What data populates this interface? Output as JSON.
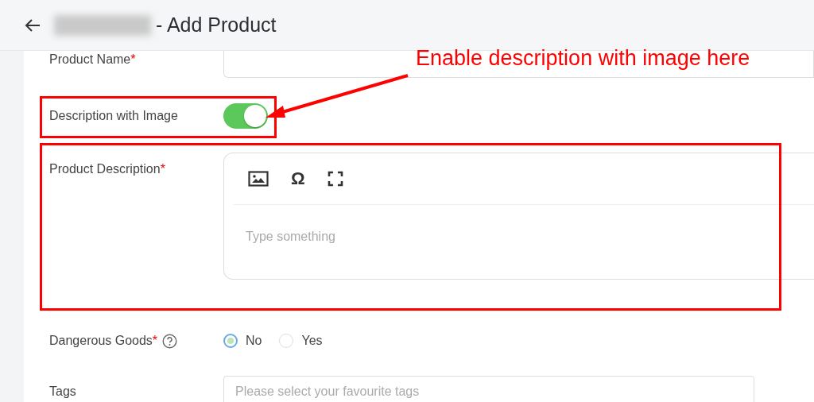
{
  "header": {
    "title": "- Add Product"
  },
  "form": {
    "product_name": {
      "label": "Product Name",
      "required_mark": "*"
    },
    "description_with_image": {
      "label": "Description with Image",
      "on": true
    },
    "product_description": {
      "label": "Product Description",
      "required_mark": "*",
      "placeholder": "Type something",
      "toolbar": [
        {
          "kind": "image"
        },
        {
          "kind": "omega",
          "symbol": "Ω"
        },
        {
          "kind": "fullscreen"
        }
      ]
    },
    "dangerous_goods": {
      "label": "Dangerous Goods",
      "required_mark": "*",
      "options": [
        {
          "label": "No",
          "selected": true
        },
        {
          "label": "Yes",
          "selected": false
        }
      ]
    },
    "tags": {
      "label": "Tags",
      "placeholder": "Please select your favourite tags"
    }
  },
  "annotation": {
    "text": "Enable description with image here"
  }
}
